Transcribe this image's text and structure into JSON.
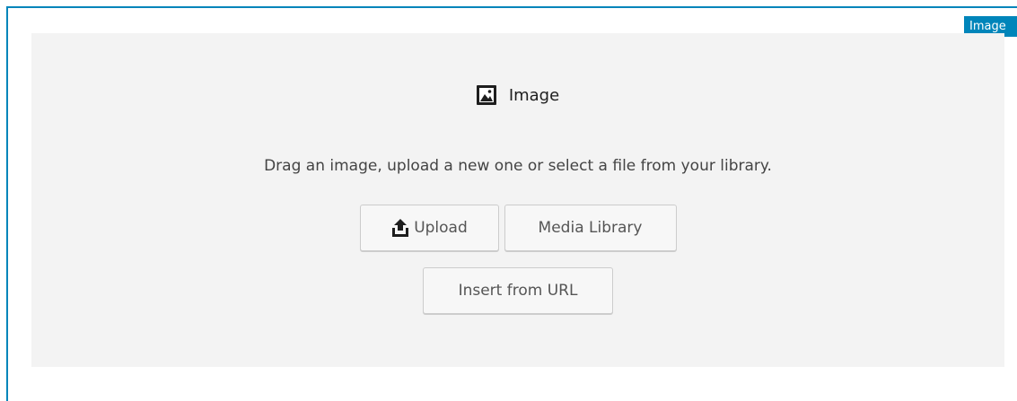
{
  "block": {
    "tag_label": "Image",
    "accent_color": "#0085ba"
  },
  "placeholder": {
    "icon": "image-icon",
    "title": "Image",
    "instructions": "Drag an image, upload a new one or select a file from your library.",
    "buttons": {
      "upload_label": "Upload",
      "upload_icon": "upload-icon",
      "media_library_label": "Media Library",
      "insert_from_url_label": "Insert from URL"
    }
  }
}
